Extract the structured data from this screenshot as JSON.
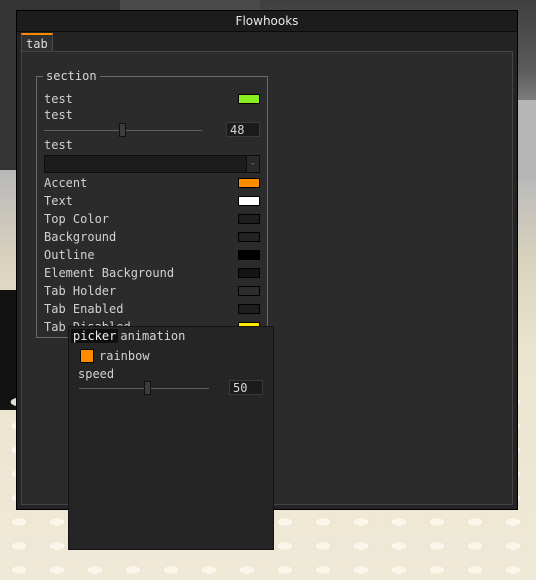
{
  "window": {
    "title": "Flowhooks"
  },
  "tabs": [
    {
      "label": "tab",
      "active": true
    }
  ],
  "section": {
    "title": "section",
    "toggle": {
      "label": "test",
      "color": "#88ee22"
    },
    "slider": {
      "label": "test",
      "value": "48"
    },
    "dropdown": {
      "label": "test",
      "value": "",
      "arrow": "-"
    },
    "colors": [
      {
        "label": "Accent",
        "color": "#ff8c00"
      },
      {
        "label": "Text",
        "color": "#ffffff"
      },
      {
        "label": "Top Color",
        "color": "#1e1e1e"
      },
      {
        "label": "Background",
        "color": "#232323"
      },
      {
        "label": "Outline",
        "color": "#000000"
      },
      {
        "label": "Element Background",
        "color": "#141414"
      },
      {
        "label": "Tab Holder",
        "color": "#2d2d2d"
      },
      {
        "label": "Tab Enabled",
        "color": "#1e1e1e"
      },
      {
        "label": "Tab Disabled",
        "color": "#ffea00"
      }
    ]
  },
  "picker": {
    "tabs": [
      "picker",
      "animation"
    ],
    "active_tab": "picker",
    "rainbow": {
      "label": "rainbow",
      "color": "#ff8c00"
    },
    "speed": {
      "label": "speed",
      "value": "50"
    }
  }
}
